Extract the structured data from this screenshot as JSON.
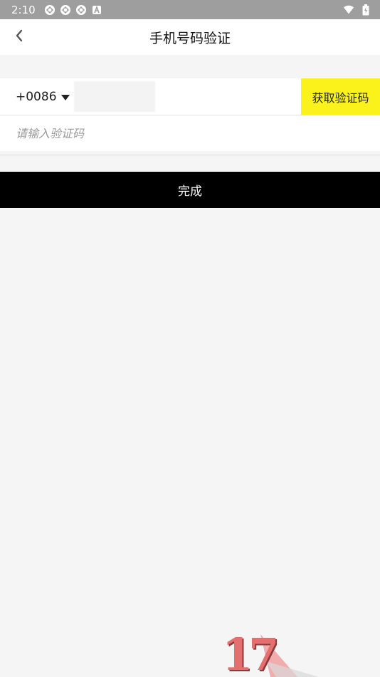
{
  "status_bar": {
    "time": "2:10",
    "notification_icons": [
      "app-notification-icon",
      "app-notification-icon",
      "app-notification-icon",
      "a-notification-icon"
    ],
    "right_icons": [
      "wifi-icon",
      "battery-icon"
    ]
  },
  "header": {
    "title": "手机号码验证",
    "back_icon": "chevron-left-icon"
  },
  "phone_row": {
    "country_code": "+0086",
    "dropdown_icon": "caret-down-icon",
    "phone_value": "",
    "get_code_label": "获取验证码"
  },
  "code_row": {
    "placeholder": "请输入验证码",
    "value": ""
  },
  "submit": {
    "label": "完成"
  },
  "watermark": {
    "text": "17"
  },
  "colors": {
    "accent_yellow": "#fbf21b",
    "submit_black": "#000000",
    "background": "#f5f5f5"
  }
}
